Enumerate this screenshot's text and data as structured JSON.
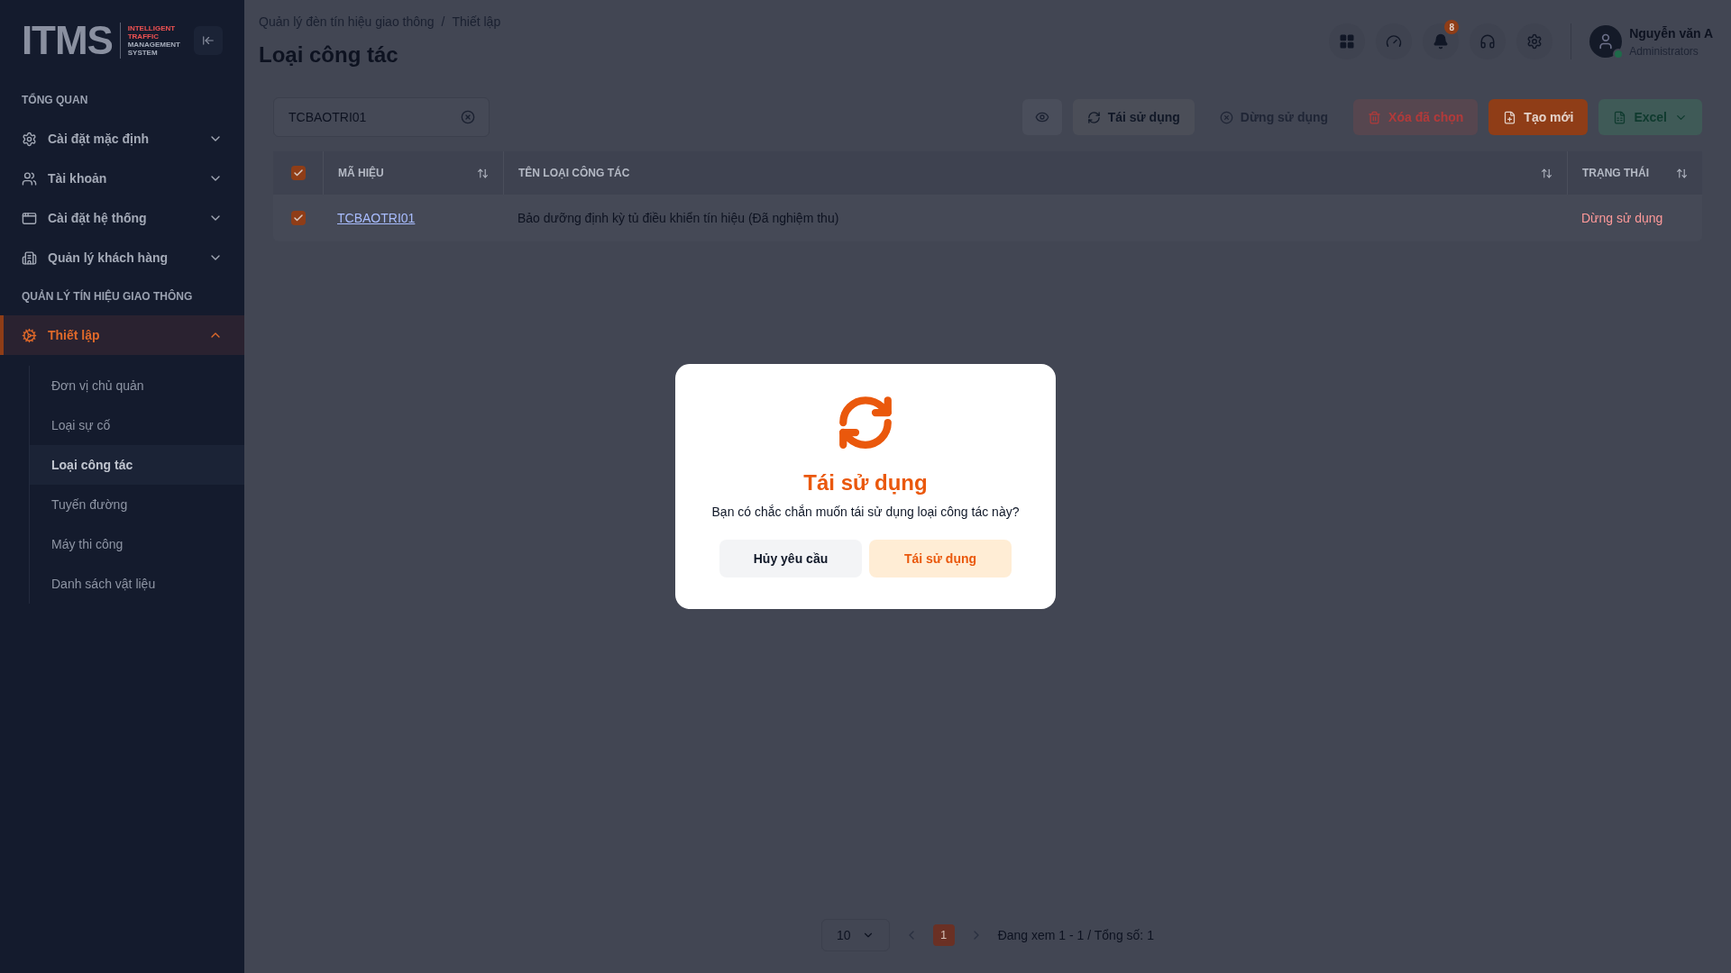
{
  "logo": {
    "mark": "ITMS",
    "tagline": [
      "INTELLIGENT",
      "TRAFFIC",
      "MANAGEMENT",
      "SYSTEM"
    ]
  },
  "sidebar": {
    "sections": [
      {
        "title": "TỔNG QUAN",
        "items": [
          {
            "label": "Cài đặt mặc định",
            "expanded": false,
            "selected": false
          },
          {
            "label": "Tài khoản",
            "expanded": false,
            "selected": false
          },
          {
            "label": "Cài đặt hệ thống",
            "expanded": false,
            "selected": false
          },
          {
            "label": "Quản lý khách hàng",
            "expanded": false,
            "selected": false
          }
        ]
      },
      {
        "title": "QUẢN LÝ TÍN HIỆU GIAO THÔNG",
        "items": [
          {
            "label": "Thiết lập",
            "expanded": true,
            "selected": true,
            "children": [
              {
                "label": "Đơn vị chủ quản",
                "selected": false
              },
              {
                "label": "Loại sự cố",
                "selected": false
              },
              {
                "label": "Loại công tác",
                "selected": true
              },
              {
                "label": "Tuyến đường",
                "selected": false
              },
              {
                "label": "Máy thi công",
                "selected": false
              },
              {
                "label": "Danh sách vật liệu",
                "selected": false
              }
            ]
          }
        ]
      }
    ]
  },
  "header": {
    "breadcrumb": [
      "Quản lý đèn tín hiệu giao thông",
      "Thiết lập"
    ],
    "separator": "/",
    "title": "Loại công tác",
    "icons": [
      {
        "kind": "apps"
      },
      {
        "kind": "gauge"
      },
      {
        "kind": "bell",
        "badge": "8"
      },
      {
        "kind": "headset"
      },
      {
        "kind": "settings"
      }
    ],
    "user": {
      "name": "Nguyễn văn A",
      "role": "Administrators",
      "online": true
    }
  },
  "toolbar": {
    "search": {
      "value": "TCBAOTRI01"
    },
    "buttons": [
      {
        "kind": "view"
      },
      {
        "kind": "reuse",
        "label": "Tái sử dụng"
      },
      {
        "kind": "stop",
        "label": "Dừng sử dụng",
        "disabled": true
      },
      {
        "kind": "delete",
        "label": "Xóa đã chọn"
      },
      {
        "kind": "create",
        "label": "Tạo mới"
      },
      {
        "kind": "excel",
        "label": "Excel"
      }
    ]
  },
  "table": {
    "all_checked": true,
    "columns": [
      {
        "label": "MÃ HIỆU",
        "sortable": true
      },
      {
        "label": "TÊN LOẠI CÔNG TÁC",
        "sortable": true
      },
      {
        "label": "TRẠNG THÁI",
        "sortable": true
      }
    ],
    "rows": [
      {
        "checked": true,
        "code": "TCBAOTRI01",
        "name": "Bảo dưỡng định kỳ tủ điều khiển tín hiệu (Đã nghiệm thu)",
        "status": "Dừng sử dụng",
        "active": false
      }
    ]
  },
  "pagination": {
    "page_size": "10",
    "pages": [
      {
        "label": "1",
        "selected": true
      }
    ],
    "summary": "Đang xem 1 - 1 / Tổng số: 1"
  },
  "dialog": {
    "title": "Tái sử dụng",
    "message": "Bạn có chắc chắn muốn tái sử dụng loại công tác này?",
    "buttons": [
      {
        "kind": "cancel",
        "label": "Hủy yêu cầu"
      },
      {
        "kind": "confirm",
        "label": "Tái sử dụng"
      }
    ]
  }
}
